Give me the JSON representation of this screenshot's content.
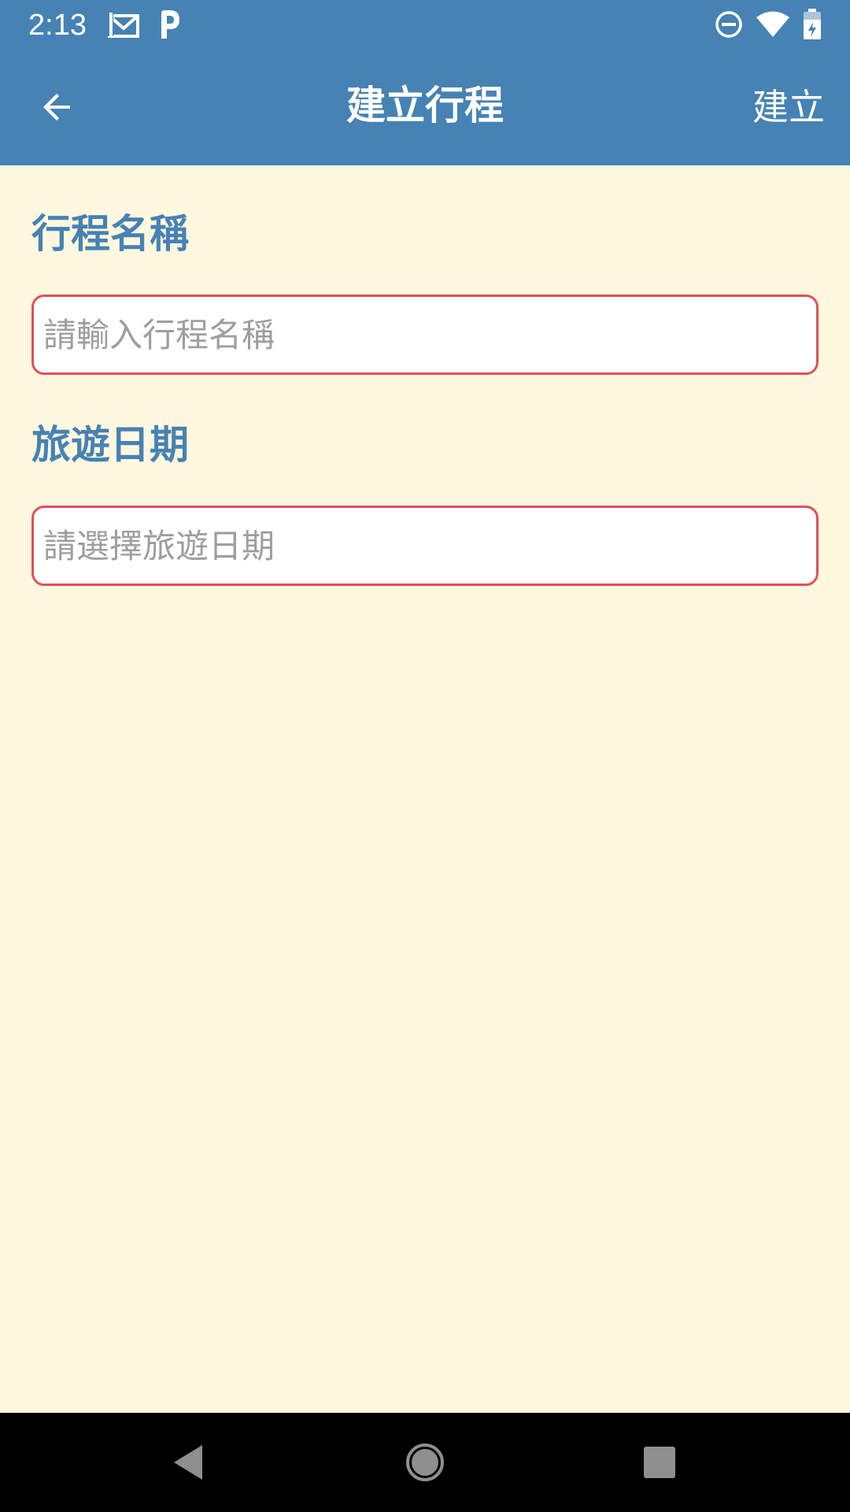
{
  "status_bar": {
    "time": "2:13",
    "left_icons": [
      "gmail-icon",
      "parking-icon"
    ],
    "right_icons": [
      "dnd-icon",
      "wifi-icon",
      "battery-icon"
    ]
  },
  "app_bar": {
    "title": "建立行程",
    "action_label": "建立",
    "back_icon": "arrow-back-icon"
  },
  "form": {
    "trip_name": {
      "label": "行程名稱",
      "placeholder": "請輸入行程名稱",
      "value": ""
    },
    "travel_date": {
      "label": "旅遊日期",
      "placeholder": "請選擇旅遊日期",
      "value": ""
    }
  },
  "nav_bar": {
    "buttons": [
      "back-triangle-icon",
      "home-circle-icon",
      "recents-square-icon"
    ]
  },
  "colors": {
    "primary": "#4682B4",
    "background": "#FFF8DF",
    "input_border": "#E0505A",
    "placeholder": "#9E9E9E"
  }
}
